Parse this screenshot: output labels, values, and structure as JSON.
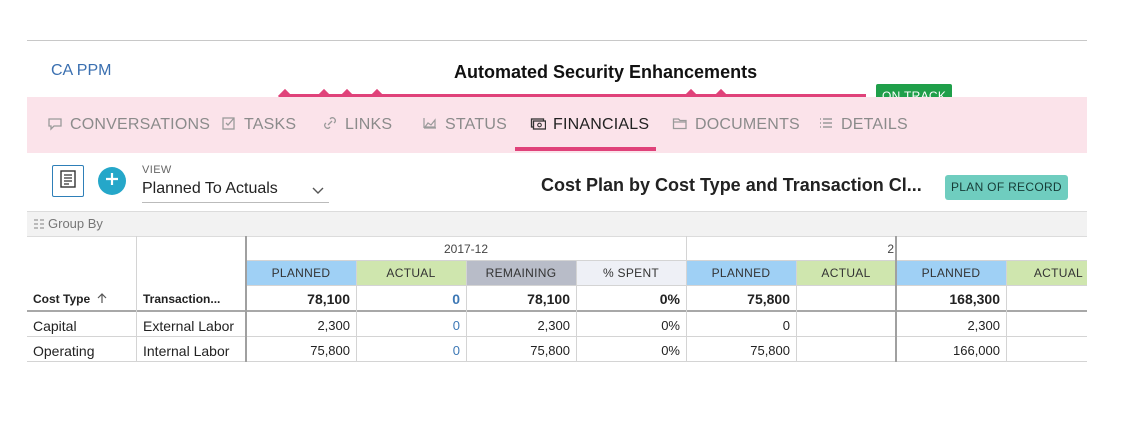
{
  "app": {
    "name": "CA PPM"
  },
  "project": {
    "title": "Automated Security Enhancements",
    "status": "ON TRACK"
  },
  "colors": {
    "accent": "#e0427a",
    "status_green": "#1f9f4a",
    "tab_bg": "#fbe3ea",
    "link_blue": "#3a6fb0"
  },
  "tabs": [
    {
      "label": "CONVERSATIONS",
      "icon": "speech-bubble-icon"
    },
    {
      "label": "TASKS",
      "icon": "checkbox-icon"
    },
    {
      "label": "LINKS",
      "icon": "link-icon"
    },
    {
      "label": "STATUS",
      "icon": "area-chart-icon"
    },
    {
      "label": "FINANCIALS",
      "icon": "money-icon",
      "active": true
    },
    {
      "label": "DOCUMENTS",
      "icon": "folder-icon"
    },
    {
      "label": "DETAILS",
      "icon": "list-icon"
    }
  ],
  "toolbar": {
    "view_label": "VIEW",
    "view_value": "Planned To Actuals",
    "plan_title": "Cost Plan by Cost Type and Transaction Cl...",
    "plan_badge": "PLAN OF RECORD"
  },
  "grid": {
    "group_by": "Group By",
    "columns": {
      "cost_type": "Cost Type",
      "transaction": "Transaction..."
    },
    "periods": [
      {
        "label": "2017-12",
        "headers": [
          "PLANNED",
          "ACTUAL",
          "REMAINING",
          "% SPENT"
        ],
        "totals": [
          "78,100",
          "0",
          "78,100",
          "0%"
        ]
      },
      {
        "label": "2",
        "headers": [
          "PLANNED",
          "ACTUAL"
        ],
        "totals": [
          "75,800",
          ""
        ]
      }
    ],
    "summary": {
      "headers": [
        "PLANNED",
        "ACTUAL"
      ],
      "totals": [
        "168,300",
        ""
      ]
    },
    "rows": [
      {
        "cost_type": "Capital",
        "transaction": "External Labor",
        "p1": [
          "2,300",
          "0",
          "2,300",
          "0%"
        ],
        "p2": [
          "0",
          ""
        ],
        "sum": [
          "2,300",
          ""
        ]
      },
      {
        "cost_type": "Operating",
        "transaction": "Internal Labor",
        "p1": [
          "75,800",
          "0",
          "75,800",
          "0%"
        ],
        "p2": [
          "75,800",
          ""
        ],
        "sum": [
          "166,000",
          ""
        ]
      }
    ]
  }
}
